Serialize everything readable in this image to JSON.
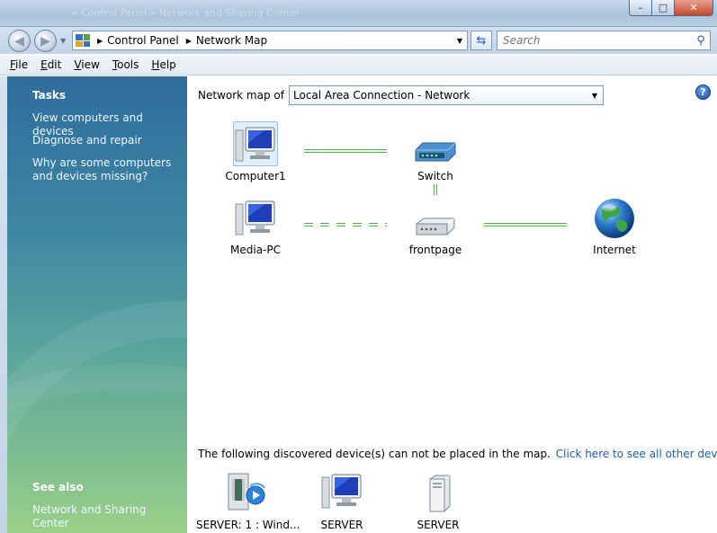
{
  "window": {
    "ghost_title": "« Control Panel » Network and Sharing Center",
    "minimize": "–",
    "maximize": "□",
    "close": "✕"
  },
  "nav": {
    "back": "◀",
    "forward": "▶",
    "breadcrumbs": [
      "Control Panel",
      "Network Map"
    ],
    "search_placeholder": "Search"
  },
  "menu": {
    "file": {
      "key": "F",
      "rest": "ile"
    },
    "edit": {
      "key": "E",
      "rest": "dit"
    },
    "view": {
      "key": "V",
      "rest": "iew"
    },
    "tools": {
      "key": "T",
      "rest": "ools"
    },
    "help": {
      "key": "H",
      "rest": "elp"
    }
  },
  "sidebar": {
    "tasks_heading": "Tasks",
    "tasks": [
      "View computers and devices",
      "Diagnose and repair",
      "Why are some computers and devices missing?"
    ],
    "see_also_heading": "See also",
    "see_also": [
      "Network and Sharing Center"
    ]
  },
  "main": {
    "map_of_label": "Network map of",
    "map_of_value": "Local Area Connection - Network",
    "help": "?",
    "nodes": {
      "computer1": "Computer1",
      "switch": "Switch",
      "media_pc": "Media-PC",
      "frontpage": "frontpage",
      "internet": "Internet"
    },
    "discovered_text": "The following discovered device(s) can not be placed in the map.",
    "discovered_link": "Click here to see all other devices.",
    "discovered_devices": [
      "SERVER: 1 : Wind...",
      "SERVER",
      "SERVER"
    ]
  },
  "colors": {
    "link_line": "#4cb84c",
    "link_text": "#1a5fb4",
    "sidebar_top": "#2f6c9d",
    "sidebar_bottom": "#9bd08a"
  }
}
